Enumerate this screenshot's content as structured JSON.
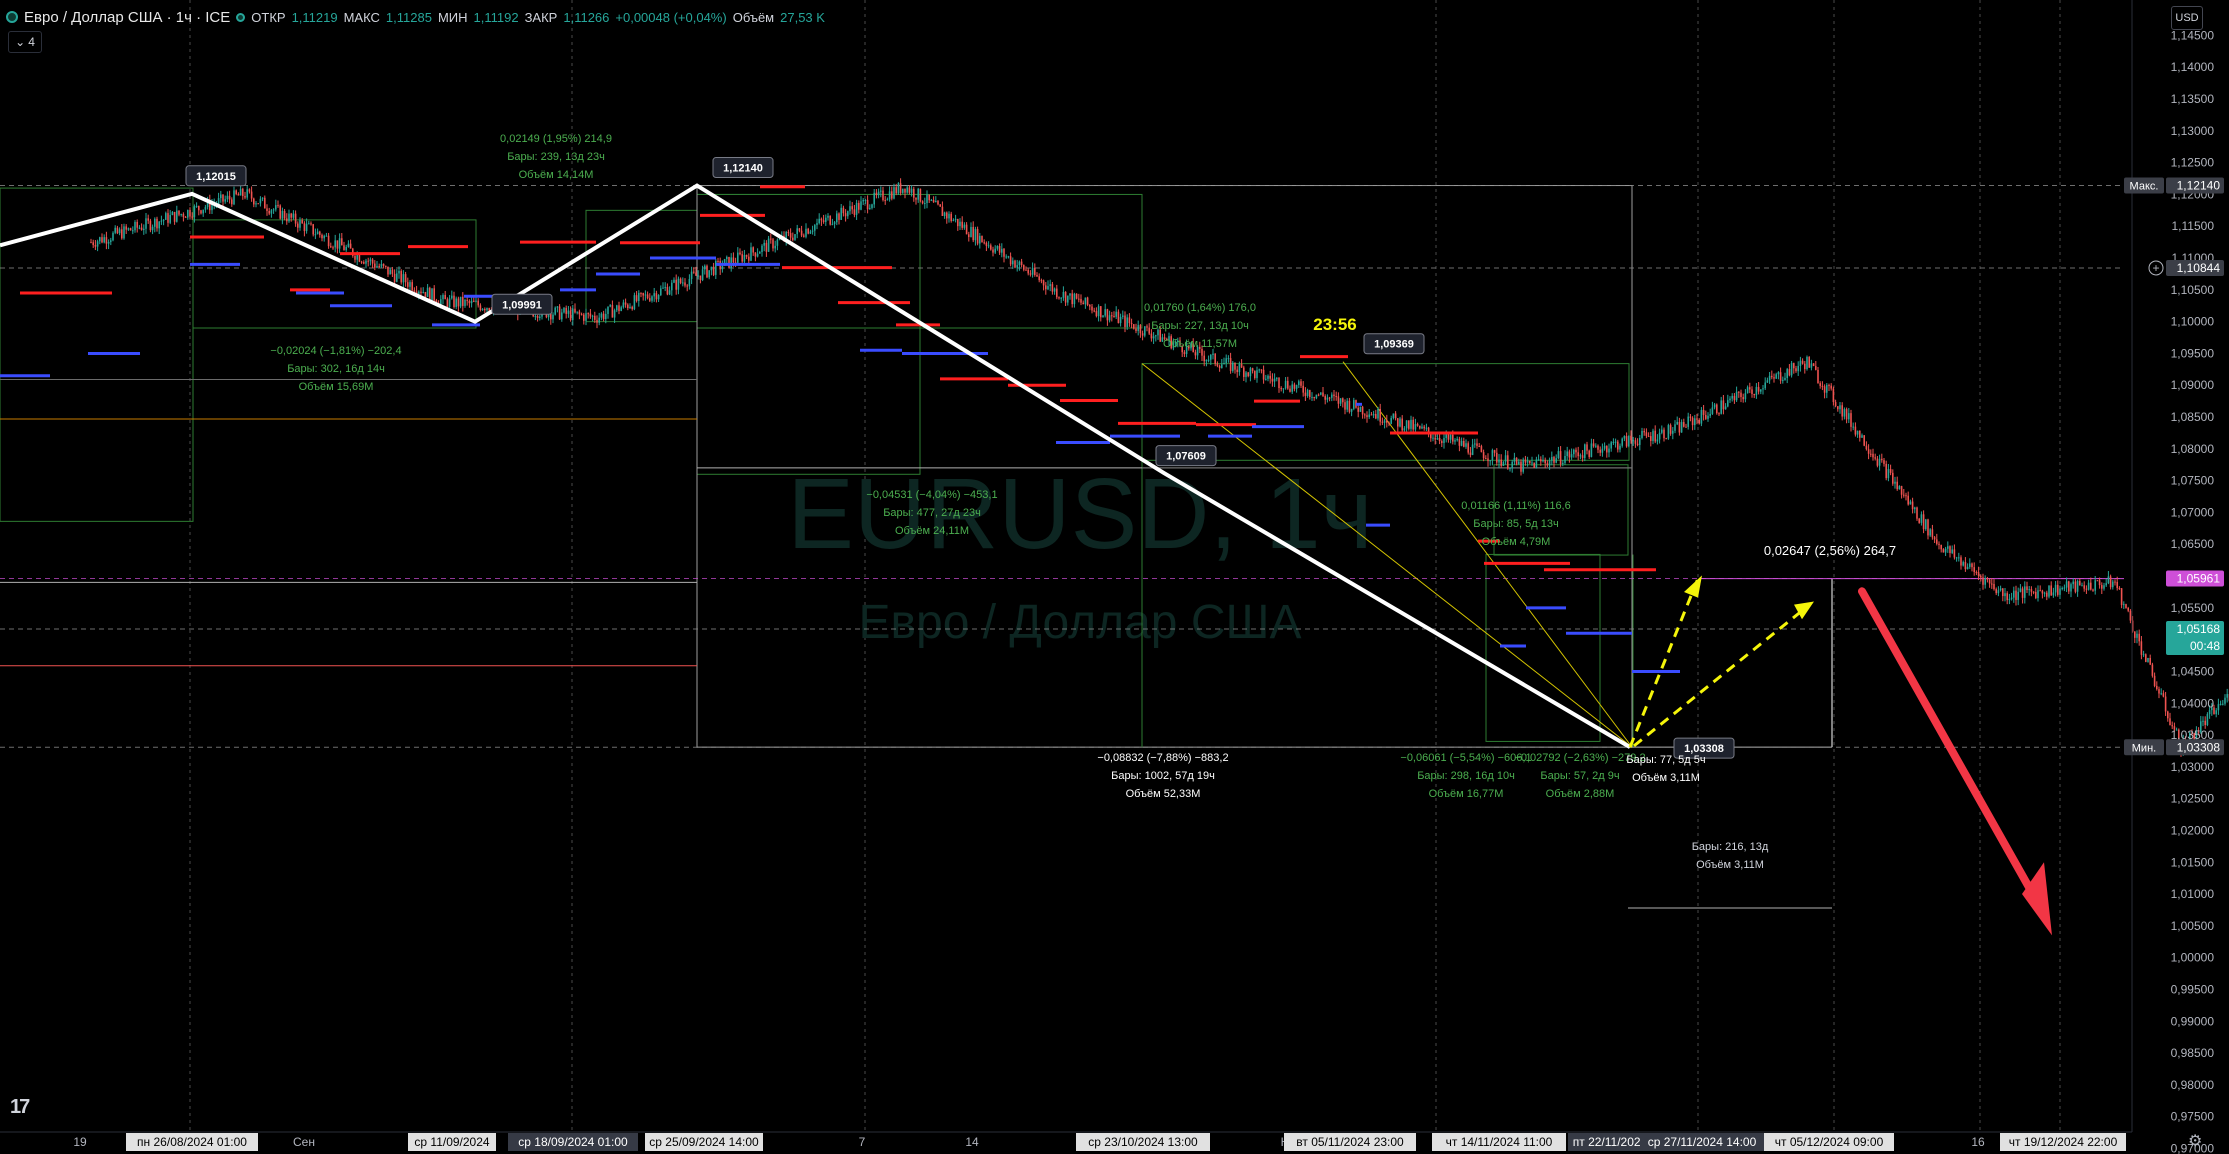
{
  "header": {
    "title": "Евро / Доллар США · 1ч · ICE",
    "ohlc": [
      {
        "k": "ОТКР",
        "v": "1,11219"
      },
      {
        "k": "МАКС",
        "v": "1,11285"
      },
      {
        "k": "МИН",
        "v": "1,11192"
      },
      {
        "k": "ЗАКР",
        "v": "1,11266"
      },
      {
        "k": "",
        "v": "+0,00048 (+0,04%)"
      },
      {
        "k": "Объём",
        "v": "27,53 K"
      }
    ],
    "indicator_count": "4",
    "currency": "USD"
  },
  "watermark": {
    "symbol": "EURUSD, 1ч",
    "name": "Евро / Доллар США"
  },
  "colors": {
    "up": "#26a69a",
    "down": "#ef5350",
    "red": "#ff1f1f",
    "blue": "#3a4cff",
    "white": "#ffffff",
    "yellow": "#f5f50a",
    "arrow": "#f23645",
    "price_tag": "#26a69a",
    "target_tag": "#ce4fd8"
  },
  "chart_data": {
    "type": "line",
    "title": "Евро / Доллар США · 1ч · ICE",
    "xlabel": "",
    "ylabel": "",
    "ylim": [
      0.9685,
      1.149
    ],
    "grid": true,
    "y_ticks": [
      "1,14500",
      "1,14000",
      "1,13500",
      "1,13000",
      "1,12500",
      "1,12000",
      "1,11500",
      "1,11000",
      "1,10500",
      "1,10000",
      "1,09500",
      "1,09000",
      "1,08500",
      "1,08000",
      "1,07500",
      "1,07000",
      "1,06500",
      "1,06000",
      "1,05500",
      "1,05000",
      "1,04500",
      "1,04000",
      "1,03500",
      "1,03000",
      "1,02500",
      "1,02000",
      "1,01500",
      "1,01000",
      "1,00500",
      "1,00000",
      "0,99500",
      "0,99000",
      "0,98500",
      "0,98000",
      "0,97500",
      "0,97000"
    ],
    "x_ticks": [
      "19",
      "Сен",
      "7",
      "14",
      "Н",
      "16"
    ],
    "x_date_labels": [
      "пн 26/08/2024  01:00",
      "ср 11/09/2024",
      "ср 18/09/2024  01:00",
      "ср 25/09/2024  14:00",
      "ср 23/10/2024  13:00",
      "вт 05/11/2024  23:00",
      "чт 14/11/2024  11:00",
      "пт 22/11/2024",
      "ср 27/11/2024  14:00",
      "чт 05/12/2024  09:00",
      "чт 19/12/2024  22:00"
    ],
    "price_tags": [
      {
        "label": "Макс.",
        "value": "1,12140"
      },
      {
        "label": "",
        "value": "1,10844"
      },
      {
        "label": "",
        "value": "1,05961"
      },
      {
        "label": "",
        "value": "1,05168",
        "sub": "00:48"
      },
      {
        "label": "Мин.",
        "value": "1,03308"
      }
    ],
    "series": [
      {
        "name": "Евро / Доллар США",
        "x": [
          "2024-08-19",
          "2024-08-26",
          "2024-09-04",
          "2024-09-11",
          "2024-09-18",
          "2024-09-25",
          "2024-10-02",
          "2024-10-09",
          "2024-10-16",
          "2024-10-23",
          "2024-10-30",
          "2024-11-05",
          "2024-11-11",
          "2024-11-14",
          "2024-11-19",
          "2024-11-22",
          "2024-11-26",
          "2024-11-28"
        ],
        "y": [
          1.1125,
          1.1201,
          1.1032,
          1.1007,
          1.1108,
          1.1213,
          1.1045,
          1.094,
          1.086,
          1.0772,
          1.083,
          1.0937,
          1.065,
          1.057,
          1.059,
          1.0331,
          1.048,
          1.0517
        ]
      }
    ],
    "pivots": [
      {
        "value": "1,12015"
      },
      {
        "value": "1,09991"
      },
      {
        "value": "1,12140"
      },
      {
        "value": "1,07609"
      },
      {
        "value": "1,09369"
      },
      {
        "value": "1,03308"
      }
    ],
    "measures": [
      {
        "text": [
          "0,02149 (1,95%) 214,9",
          "Бары: 239, 13д 23ч",
          "Объём 14,14M"
        ]
      },
      {
        "text": [
          "−0,02024 (−1,81%) −202,4",
          "Бары: 302, 16д 14ч",
          "Объём 15,69M"
        ]
      },
      {
        "text": [
          "0,01760 (1,64%) 176,0",
          "Бары: 227, 13д 10ч",
          "Объём 11,57M"
        ]
      },
      {
        "text": [
          "−0,04531 (−4,04%) −453,1",
          "Бары: 477, 27д 23ч",
          "Объём 24,11M"
        ]
      },
      {
        "text": [
          "0,01166 (1,11%) 116,6",
          "Бары: 85, 5д 13ч",
          "Объём 4,79M"
        ]
      },
      {
        "text": [
          "−0,08832 (−7,88%) −883,2",
          "Бары: 1002, 57д 19ч",
          "Объём 52,33M"
        ]
      },
      {
        "text": [
          "−0,06061 (−5,54%) −606,1",
          "Бары: 298, 16д 10ч",
          "Объём 16,77M"
        ]
      },
      {
        "text": [
          "−0,02792 (−2,63%) −279,2",
          "Бары: 57, 2д 9ч",
          "Объём 2,88M"
        ]
      },
      {
        "text": [
          "Бары: 77, 5д 5ч",
          "Объём 3,11M"
        ]
      },
      {
        "text": [
          "0,02647 (2,56%) 264,7"
        ]
      },
      {
        "text": [
          "Бары: 216, 13д",
          "Объём 3,11M"
        ]
      }
    ],
    "annotations": [
      "23:56"
    ]
  }
}
